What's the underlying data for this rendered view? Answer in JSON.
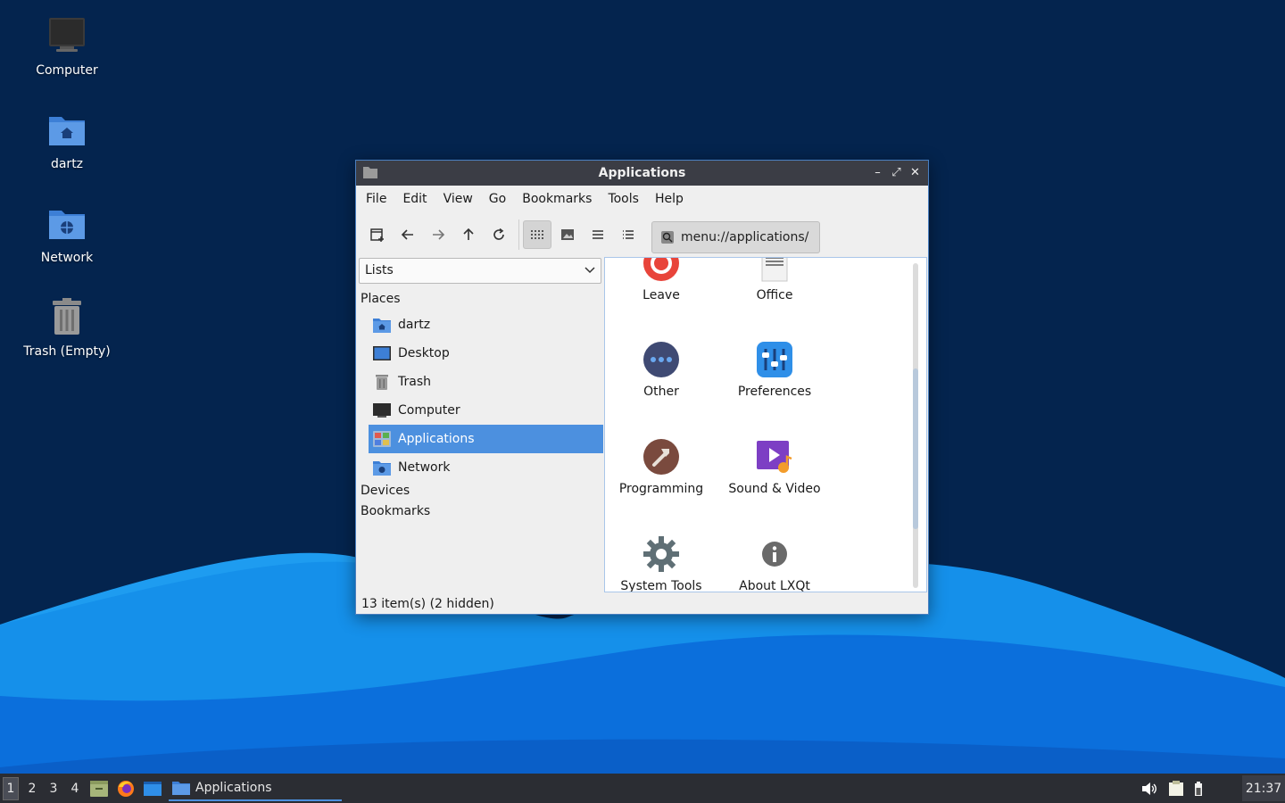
{
  "colors": {
    "desktop_bg": "#04244e",
    "wave_light": "#1e9cf0",
    "wave_dark": "#0a5fc8",
    "titlebar": "#3b3d45",
    "selection": "#4c90df",
    "taskbar": "#2b2d33"
  },
  "desktop": {
    "icons": [
      {
        "label": "Computer",
        "icon": "computer-icon"
      },
      {
        "label": "dartz",
        "icon": "home-folder-icon"
      },
      {
        "label": "Network",
        "icon": "network-folder-icon"
      },
      {
        "label": "Trash (Empty)",
        "icon": "trash-icon"
      }
    ]
  },
  "window": {
    "title": "Applications",
    "controls": {
      "minimize": "–",
      "maximize": "⤢",
      "close": "✕"
    },
    "menu": [
      "File",
      "Edit",
      "View",
      "Go",
      "Bookmarks",
      "Tools",
      "Help"
    ],
    "toolbar": {
      "buttons": [
        "new-tab-icon",
        "back-icon",
        "forward-icon",
        "up-icon",
        "reload-icon",
        "icon-view-icon",
        "thumbnail-view-icon",
        "compact-view-icon",
        "detailed-view-icon"
      ],
      "active_view": "icon-view-icon",
      "address": "menu://applications/"
    },
    "side_pane": {
      "mode": "Lists",
      "places_heading": "Places",
      "places": [
        {
          "label": "dartz",
          "icon": "home-folder-icon"
        },
        {
          "label": "Desktop",
          "icon": "desktop-icon"
        },
        {
          "label": "Trash",
          "icon": "trash-icon"
        },
        {
          "label": "Computer",
          "icon": "computer-icon"
        },
        {
          "label": "Applications",
          "icon": "applications-icon",
          "selected": true
        },
        {
          "label": "Network",
          "icon": "network-folder-icon"
        }
      ],
      "devices_heading": "Devices",
      "bookmarks_heading": "Bookmarks"
    },
    "apps": [
      {
        "label": "Leave",
        "icon": "leave-icon"
      },
      {
        "label": "Office",
        "icon": "office-icon"
      },
      {
        "label": "Other",
        "icon": "other-icon"
      },
      {
        "label": "Preferences",
        "icon": "preferences-icon"
      },
      {
        "label": "Programming",
        "icon": "programming-icon"
      },
      {
        "label": "Sound & Video",
        "icon": "sound-video-icon"
      },
      {
        "label": "System Tools",
        "icon": "system-tools-icon"
      },
      {
        "label": "About LXQt",
        "icon": "about-icon"
      }
    ],
    "status": "13 item(s) (2 hidden)"
  },
  "taskbar": {
    "workspaces": [
      "1",
      "2",
      "3",
      "4"
    ],
    "active_workspace": "1",
    "launchers": [
      "file-manager-icon",
      "firefox-icon",
      "show-desktop-icon"
    ],
    "tasks": [
      {
        "label": "Applications",
        "icon": "folder-icon"
      }
    ],
    "tray": [
      "volume-icon",
      "clipboard-icon",
      "battery-icon"
    ],
    "clock": "21:37"
  }
}
